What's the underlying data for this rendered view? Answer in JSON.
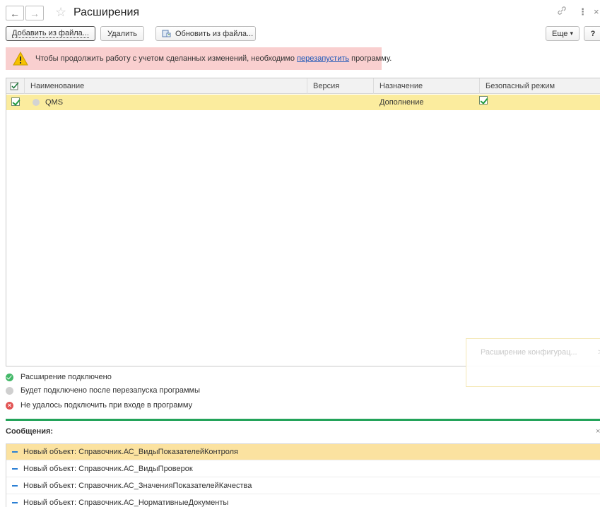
{
  "window": {
    "title": "Расширения",
    "back_icon": "←",
    "forward_icon": "→",
    "favorite_icon": "☆",
    "link_icon": "🔗",
    "more_icon": "⋮",
    "close_icon": "×"
  },
  "toolbar": {
    "add_from_file": "Добавить из файла...",
    "delete": "Удалить",
    "update_from_file": "Обновить из файла...",
    "more": "Еще",
    "more_arrow": "▾",
    "help": "?"
  },
  "warning": {
    "text_before": "Чтобы продолжить работу с учетом сделанных изменений, необходимо ",
    "link": "перезапустить",
    "text_after": " программу."
  },
  "table": {
    "columns": {
      "name": "Наименование",
      "version": "Версия",
      "purpose": "Назначение",
      "safe_mode": "Безопасный режим"
    },
    "rows": [
      {
        "active": true,
        "status": "waiting",
        "name": "QMS",
        "version": "",
        "purpose": "Дополнение",
        "safe_mode": true
      }
    ]
  },
  "popup": {
    "text": "Расширение конфигурац...",
    "close": ">"
  },
  "legend": [
    {
      "status": "connected",
      "label": "Расширение подключено"
    },
    {
      "status": "waiting",
      "label": "Будет подключено после перезапуска программы"
    },
    {
      "status": "error",
      "label": "Не удалось подключить при входе в программу"
    }
  ],
  "messages": {
    "title": "Сообщения:",
    "close": "×",
    "items": [
      "Новый объект: Справочник.АС_ВидыПоказателейКонтроля",
      "Новый объект: Справочник.АС_ВидыПроверок",
      "Новый объект: Справочник.АС_ЗначенияПоказателейКачества",
      "Новый объект: Справочник.АС_НормативныеДокументы"
    ]
  },
  "colors": {
    "warning_bg": "#f9cfcf",
    "selected_row": "#fbec9e",
    "separator": "#23a35a",
    "link": "#1a56b8",
    "connected": "#43b868",
    "error": "#e25555"
  }
}
